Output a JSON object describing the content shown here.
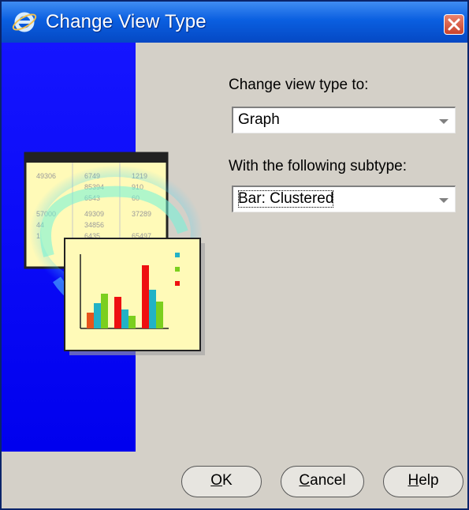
{
  "window": {
    "title": "Change View Type",
    "title_icon": "ie-logo-icon",
    "close_icon": "close-icon",
    "colors": {
      "titlebar": "#0a5fe0",
      "art_panel": "#0000ee",
      "dialog": "#d4d0c8",
      "close": "#d9553d"
    }
  },
  "form": {
    "view_type_label": "Change view type to:",
    "view_type_value": "Graph",
    "subtype_label": "With the following subtype:",
    "subtype_value": "Bar: Clustered"
  },
  "buttons": {
    "ok": {
      "mnemonic": "O",
      "rest": "K"
    },
    "cancel": {
      "mnemonic": "C",
      "rest": "ancel"
    },
    "help": {
      "mnemonic": "H",
      "rest": "elp"
    }
  },
  "illustration": {
    "table_cells": [
      "49306",
      "6749",
      "1219",
      "85394",
      "910",
      "6543",
      "60",
      "57000",
      "49309",
      "37289",
      "44",
      "34856",
      "1",
      "6435",
      "65497"
    ]
  }
}
